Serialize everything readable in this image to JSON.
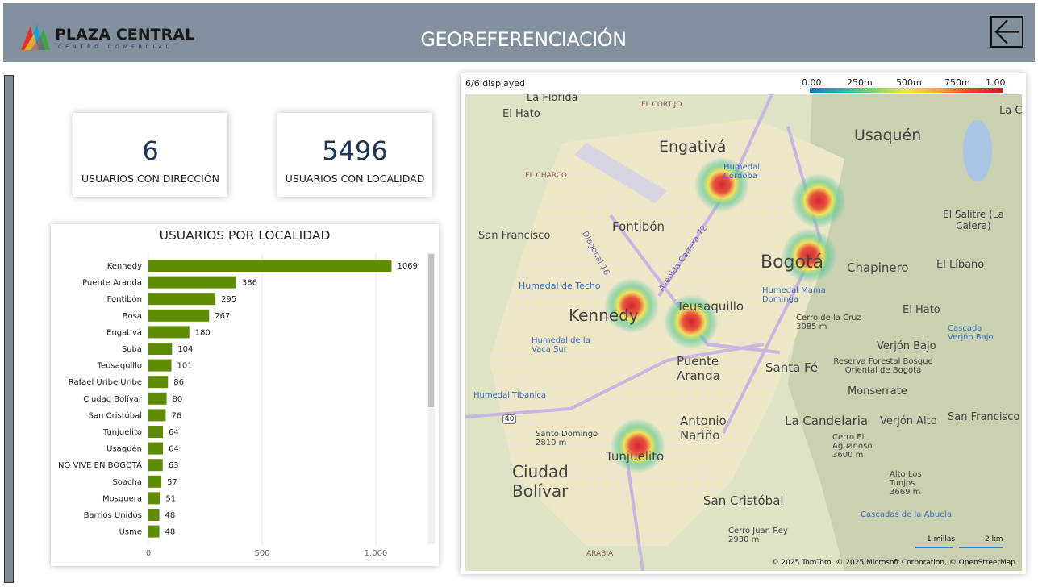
{
  "header": {
    "logo_name": "PLAZA CENTRAL",
    "logo_tagline": "CENTRO COMERCIAL",
    "title": "GEOREFERENCIACIÓN",
    "back_icon": "arrow-left-icon"
  },
  "kpis": [
    {
      "value": "6",
      "label": "USUARIOS CON DIRECCIÓN"
    },
    {
      "value": "5496",
      "label": "USUARIOS CON LOCALIDAD"
    }
  ],
  "bar_chart": {
    "title": "USUARIOS POR LOCALIDAD",
    "axis_ticks": [
      "0",
      "500",
      "1.000"
    ]
  },
  "chart_data": {
    "type": "bar",
    "orientation": "horizontal",
    "title": "USUARIOS POR LOCALIDAD",
    "categories": [
      "Kennedy",
      "Puente Aranda",
      "Fontibón",
      "Bosa",
      "Engativá",
      "Suba",
      "Teusaquillo",
      "Rafael Uribe Uribe",
      "Ciudad Bolívar",
      "San Cristóbal",
      "Tunjuelito",
      "Usaquén",
      "NO VIVE EN BOGOTÁ",
      "Soacha",
      "Mosquera",
      "Barrios Unidos",
      "Usme"
    ],
    "values": [
      1069,
      386,
      295,
      267,
      180,
      104,
      101,
      86,
      80,
      76,
      64,
      64,
      63,
      57,
      51,
      48,
      48
    ],
    "xlim": [
      0,
      1200
    ],
    "x_ticks": [
      0,
      500,
      1000
    ],
    "bar_color": "#5e8b00",
    "grid": true
  },
  "map": {
    "status": "6/6 displayed",
    "legend_labels": [
      "0.00",
      "250m",
      "500m",
      "750m",
      "1.00"
    ],
    "attribution": "© 2025 TomTom, © 2025 Microsoft Corporation, © OpenStreetMap",
    "scale_labels": [
      "1 millas",
      "2 km"
    ],
    "places": [
      {
        "name": "La Florida",
        "size": 13
      },
      {
        "name": "El Hato",
        "size": 13
      },
      {
        "name": "EL CORTIJO",
        "size": 9
      },
      {
        "name": "Engativá",
        "size": 19
      },
      {
        "name": "Usaquén",
        "size": 19
      },
      {
        "name": "La C",
        "size": 13
      },
      {
        "name": "EL CHARCO",
        "size": 9
      },
      {
        "name": "Humedal Córdoba",
        "size": 10
      },
      {
        "name": "Fontibón",
        "size": 15
      },
      {
        "name": "El Salitre (La Calera)",
        "size": 12
      },
      {
        "name": "San Francisco",
        "size": 13
      },
      {
        "name": "Bogotá",
        "size": 22
      },
      {
        "name": "Chapinero",
        "size": 15
      },
      {
        "name": "El Líbano",
        "size": 13
      },
      {
        "name": "Humedal de Techo",
        "size": 11
      },
      {
        "name": "Humedal Mama Dominga",
        "size": 10
      },
      {
        "name": "Kennedy",
        "size": 20
      },
      {
        "name": "Teusaquillo",
        "size": 15
      },
      {
        "name": "El Hato",
        "size": 13
      },
      {
        "name": "Cerro de la Cruz 3085 m",
        "size": 10
      },
      {
        "name": "Cascada Verjón Bajo",
        "size": 10
      },
      {
        "name": "Humedal de la Vaca Sur",
        "size": 10
      },
      {
        "name": "Verjón Bajo",
        "size": 13
      },
      {
        "name": "Puente Aranda",
        "size": 15
      },
      {
        "name": "Santa Fé",
        "size": 15
      },
      {
        "name": "Reserva Forestal Bosque Oriental de Bogotá",
        "size": 10
      },
      {
        "name": "Monserrate",
        "size": 13
      },
      {
        "name": "Humedal Tibanica",
        "size": 10
      },
      {
        "name": "Antonio Nariño",
        "size": 15
      },
      {
        "name": "La Candelaria",
        "size": 15
      },
      {
        "name": "Verjón Alto",
        "size": 13
      },
      {
        "name": "San Francisco",
        "size": 13
      },
      {
        "name": "Santo Domingo 2810 m",
        "size": 10
      },
      {
        "name": "Tunjuelito",
        "size": 15
      },
      {
        "name": "Cerro El Aguanoso 3600 m",
        "size": 10
      },
      {
        "name": "Ciudad Bolívar",
        "size": 20
      },
      {
        "name": "Alto Los Tunjos 3669 m",
        "size": 10
      },
      {
        "name": "San Cristóbal",
        "size": 15
      },
      {
        "name": "Cascadas de la Abuela",
        "size": 10
      },
      {
        "name": "Cerro Juan Rey 2930 m",
        "size": 10
      },
      {
        "name": "ARABIA",
        "size": 9
      },
      {
        "name": "40",
        "size": 9
      },
      {
        "name": "Diagonal 16",
        "size": 10
      },
      {
        "name": "Avenida Carrera 72",
        "size": 10
      }
    ]
  }
}
